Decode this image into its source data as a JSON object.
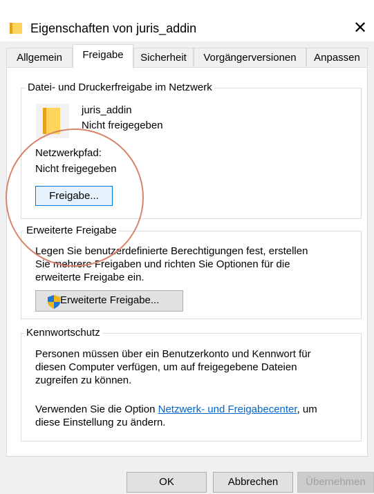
{
  "window": {
    "title": "Eigenschaften von juris_addin",
    "close_glyph": "✕"
  },
  "tabs": [
    {
      "label": "Allgemein"
    },
    {
      "label": "Freigabe"
    },
    {
      "label": "Sicherheit"
    },
    {
      "label": "Vorgängerversionen"
    },
    {
      "label": "Anpassen"
    }
  ],
  "sharing": {
    "group_title": "Datei- und Druckerfreigabe im Netzwerk",
    "folder_name": "juris_addin",
    "folder_status": "Nicht freigegeben",
    "path_label": "Netzwerkpfad:",
    "path_value": "Nicht freigegeben",
    "share_button": "Freigabe..."
  },
  "advanced": {
    "group_title": "Erweiterte Freigabe",
    "description": [
      "Legen Sie benutzerdefinierte Berechtigungen fest, erstellen",
      "Sie mehrere Freigaben und richten Sie Optionen für die",
      "erweiterte Freigabe ein."
    ],
    "button": "Erweiterte Freigabe..."
  },
  "password": {
    "group_title": "Kennwortschutz",
    "description": [
      "Personen müssen über ein Benutzerkonto und Kennwort für",
      "diesen Computer verfügen, um auf freigegebene Dateien",
      "zugreifen zu können."
    ],
    "option_prefix": "Verwenden Sie die Option ",
    "option_link": "Netzwerk- und Freigabecenter",
    "option_suffix": ", um",
    "option_line2": "diese Einstellung zu ändern."
  },
  "footer": {
    "ok": "OK",
    "cancel": "Abbrechen",
    "apply": "Übernehmen"
  },
  "colors": {
    "link": "#0066cc",
    "focus_border": "#0078d7",
    "annotation_circle": "#d9826a"
  }
}
